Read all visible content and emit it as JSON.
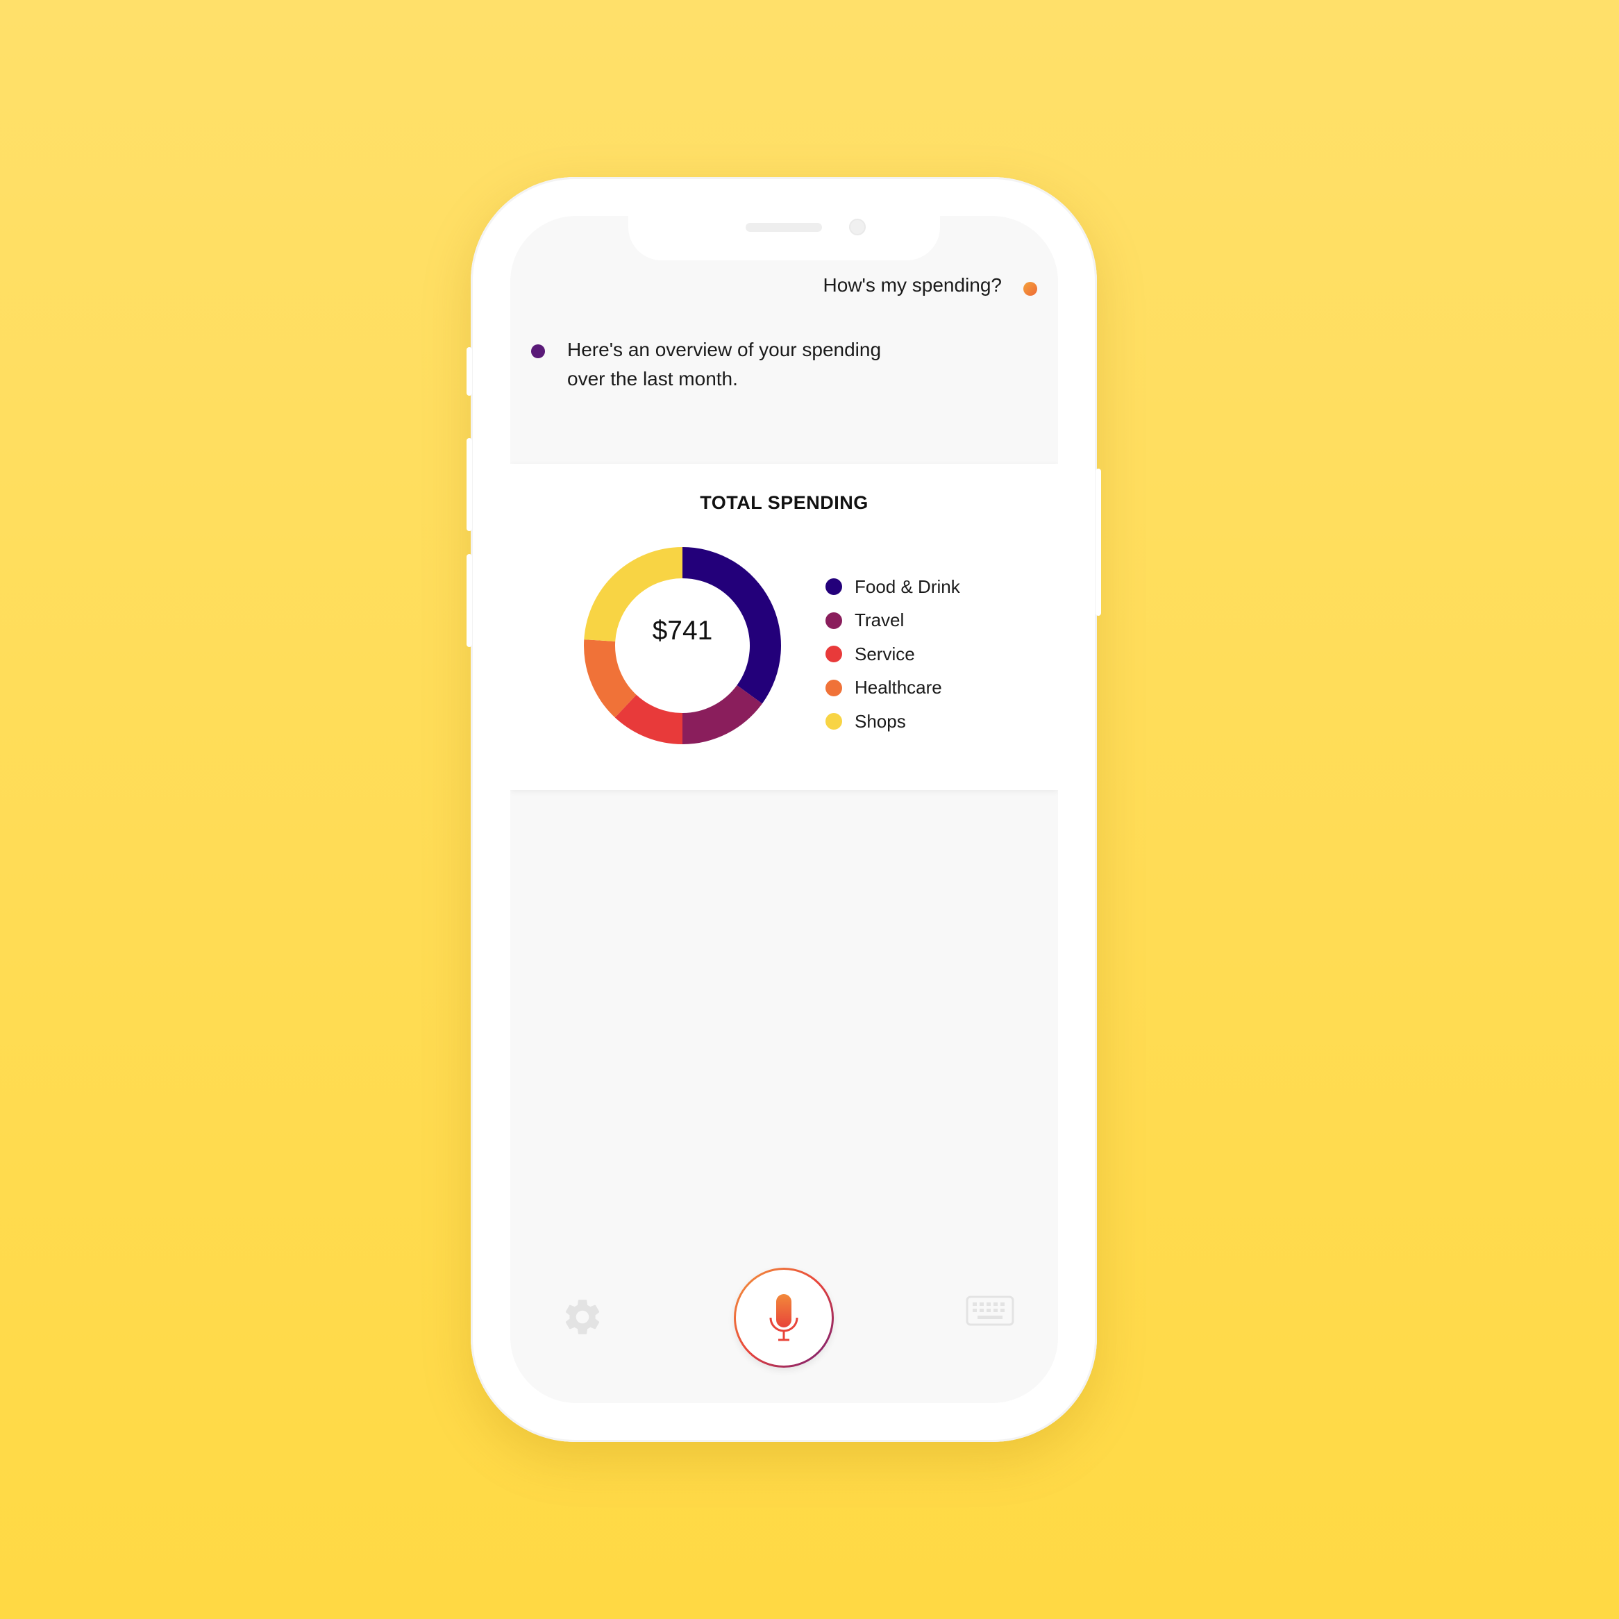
{
  "conversation": {
    "user_message": "How's my spending?",
    "bot_message": "Here's an overview of your spending over the last month."
  },
  "card": {
    "title": "TOTAL SPENDING",
    "total_value": "$741"
  },
  "chart_data": {
    "type": "pie",
    "title": "TOTAL SPENDING",
    "center_label": "$741",
    "categories": [
      "Food & Drink",
      "Travel",
      "Service",
      "Healthcare",
      "Shops"
    ],
    "values": [
      35,
      15,
      12,
      14,
      24
    ],
    "colors": [
      "#23007A",
      "#8A1E5C",
      "#E83A3A",
      "#F07238",
      "#F8D444"
    ],
    "legend_position": "right"
  },
  "icons": {
    "settings": "gear-icon",
    "microphone": "microphone-icon",
    "keyboard": "keyboard-icon"
  },
  "colors": {
    "background": "#FFDD55",
    "user_dot": "#F08A3A",
    "bot_dot": "#5A1A78",
    "screen": "#F8F8F8"
  }
}
